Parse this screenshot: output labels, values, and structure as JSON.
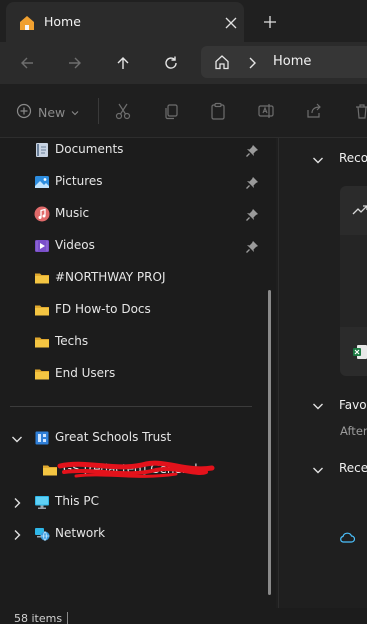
{
  "tab": {
    "title": "Home"
  },
  "address": {
    "segment": "Home"
  },
  "command_bar": {
    "new_label": "New"
  },
  "sidebar": {
    "quick_access": [
      {
        "label": "Documents",
        "icon": "documents-icon",
        "pinned": true
      },
      {
        "label": "Pictures",
        "icon": "pictures-icon",
        "pinned": true
      },
      {
        "label": "Music",
        "icon": "music-icon",
        "pinned": true
      },
      {
        "label": "Videos",
        "icon": "videos-icon",
        "pinned": true
      },
      {
        "label": "#NORTHWAY PROJ",
        "icon": "folder-icon",
        "pinned": false
      },
      {
        "label": "FD How-to Docs",
        "icon": "folder-icon",
        "pinned": false
      },
      {
        "label": "Techs",
        "icon": "folder-icon",
        "pinned": false
      },
      {
        "label": "End Users",
        "icon": "folder-icon",
        "pinned": false
      }
    ],
    "tree": [
      {
        "label": "Great Schools Trust",
        "icon": "onedrive-org-icon",
        "expanded": true
      },
      {
        "label": "GS [redacted] General",
        "icon": "folder-icon",
        "expanded": false
      },
      {
        "label": "This PC",
        "icon": "this-pc-icon",
        "expanded": false
      },
      {
        "label": "Network",
        "icon": "network-icon",
        "expanded": false
      }
    ]
  },
  "main": {
    "sections": [
      {
        "title": "Recom"
      },
      {
        "title": "Favor"
      },
      {
        "title": "Recen"
      }
    ],
    "favorites_hint": "After"
  },
  "status": {
    "items": "58 items"
  },
  "colors": {
    "accent": "#4cc2ff",
    "folder": "#f4c542",
    "redaction": "#e3121b"
  }
}
